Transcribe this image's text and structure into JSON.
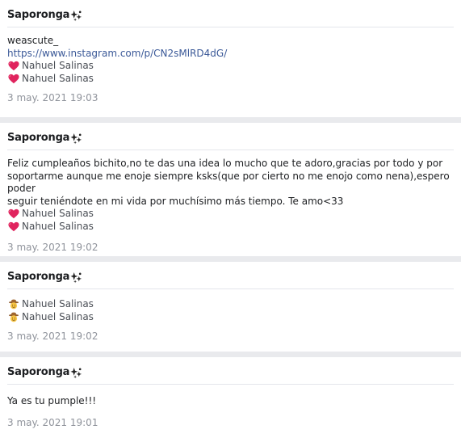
{
  "messages": [
    {
      "author": "Saporonga",
      "lines": [
        "weascute_"
      ],
      "link": "https://www.instagram.com/p/CN2sMlRD4dG/",
      "reactions": [
        {
          "icon": "heart-icon",
          "name": "Nahuel Salinas"
        },
        {
          "icon": "heart-icon",
          "name": "Nahuel Salinas"
        }
      ],
      "timestamp": "3 may. 2021 19:03"
    },
    {
      "author": "Saporonga",
      "lines": [
        "Feliz cumpleaños bichito,no te das una idea lo mucho que te adoro,gracias por todo y por",
        "soportarme aunque me enoje siempre ksks(que por cierto no me enojo como nena),espero poder",
        "seguir teniéndote en mi vida por muchísimo más tiempo. Te amo<33"
      ],
      "reactions": [
        {
          "icon": "heart-icon",
          "name": "Nahuel Salinas"
        },
        {
          "icon": "heart-icon",
          "name": "Nahuel Salinas"
        }
      ],
      "timestamp": "3 may. 2021 19:02"
    },
    {
      "author": "Saporonga",
      "lines": [],
      "reactions": [
        {
          "icon": "cowboy-face-icon",
          "name": "Nahuel Salinas"
        },
        {
          "icon": "cowboy-face-icon",
          "name": "Nahuel Salinas"
        }
      ],
      "timestamp": "3 may. 2021 19:02"
    },
    {
      "author": "Saporonga",
      "lines": [
        "Ya es tu pumple!!!"
      ],
      "reactions": [],
      "timestamp": "3 may. 2021 19:01"
    }
  ],
  "author_icon": "sparkle-icon",
  "colors": {
    "background": "#e9eaed",
    "card": "#ffffff",
    "link": "#3b5998",
    "timestamp": "#90949c",
    "heart": "#e0245e"
  }
}
